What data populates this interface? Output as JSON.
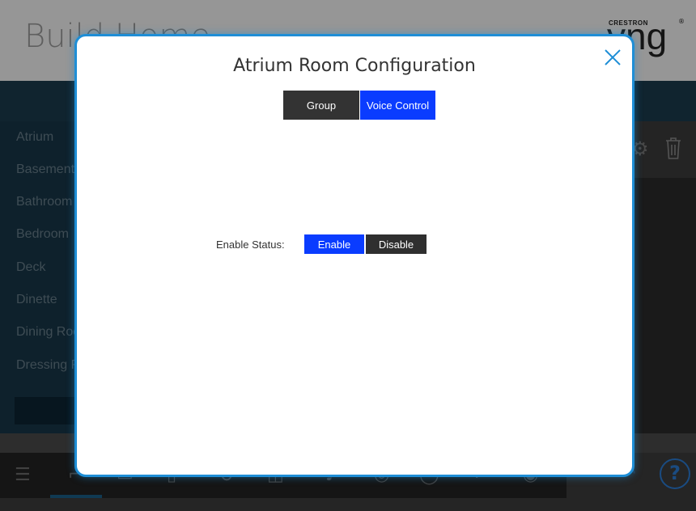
{
  "header": {
    "title": "Build Home",
    "logo_small": "CRESTRON",
    "logo_big": "yng"
  },
  "sidebar": {
    "rooms": [
      "Atrium",
      "Basement",
      "Bathroom",
      "Bedroom",
      "Deck",
      "Dinette",
      "Dining Room",
      "Dressing Room"
    ]
  },
  "right_panel": {
    "icons": [
      "gear-icon",
      "trash-icon"
    ]
  },
  "bottom_nav": {
    "icons": [
      "menu-icon",
      "door-icon",
      "image-icon",
      "shades-icon",
      "bulb-icon",
      "window-icon",
      "music-icon",
      "thermostat-icon",
      "circle-icon",
      "keypad-icon",
      "sensor-icon"
    ],
    "help_label": "?"
  },
  "modal": {
    "title": "Atrium Room Configuration",
    "tabs": [
      {
        "label": "Group",
        "active": false
      },
      {
        "label": "Voice Control",
        "active": true
      }
    ],
    "status_label": "Enable Status:",
    "enable_label": "Enable",
    "disable_label": "Disable",
    "enabled": true
  },
  "colors": {
    "accent_blue": "#0a3cff",
    "modal_border": "#1e8ed6",
    "dark_button": "#333333"
  }
}
